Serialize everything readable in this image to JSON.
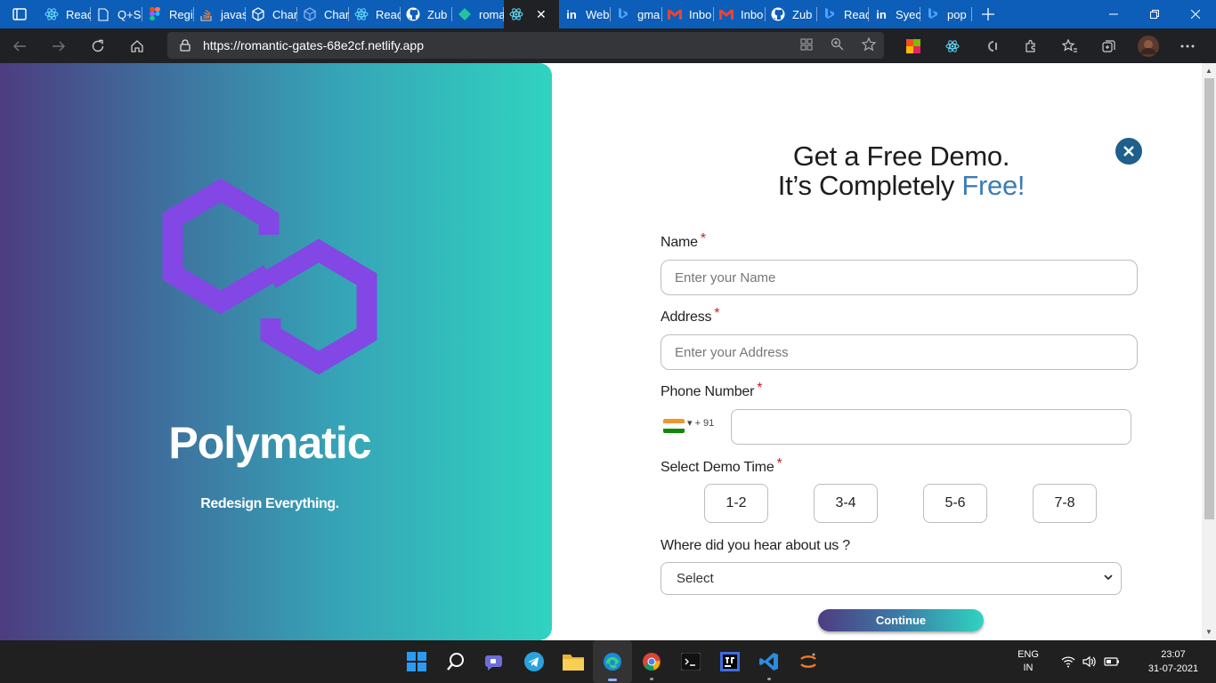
{
  "browser": {
    "tabs": [
      {
        "label": "Reac",
        "icon": "react-icon",
        "color": "#61dafb"
      },
      {
        "label": "Q+S",
        "icon": "page-icon",
        "color": "#ffffff"
      },
      {
        "label": "Regi",
        "icon": "figma-icon",
        "color": "#f24e1e"
      },
      {
        "label": "javas",
        "icon": "stackoverflow-icon",
        "color": "#f48024"
      },
      {
        "label": "Char",
        "icon": "codesandbox-icon",
        "color": "#ffffff"
      },
      {
        "label": "Char",
        "icon": "codesandbox-icon",
        "color": "#8ab4f8"
      },
      {
        "label": "Reac",
        "icon": "react-icon",
        "color": "#61dafb"
      },
      {
        "label": "Zub",
        "icon": "github-icon",
        "color": "#ffffff"
      },
      {
        "label": "roma",
        "icon": "netlify-icon",
        "color": "#25c2a0"
      }
    ],
    "active_tab": {
      "icon": "react-icon",
      "close": "✕"
    },
    "tabs_after": [
      {
        "label": "Web",
        "icon": "linkedin-icon",
        "color": "#ffffff"
      },
      {
        "label": "gma",
        "icon": "bing-icon",
        "color": "#4aa3ff"
      },
      {
        "label": "Inbo",
        "icon": "gmail-icon",
        "color": "#ea4335"
      },
      {
        "label": "Inbo",
        "icon": "gmail-icon",
        "color": "#ea4335"
      },
      {
        "label": "Zub",
        "icon": "github-icon",
        "color": "#ffffff"
      },
      {
        "label": "Reac",
        "icon": "bing-icon",
        "color": "#4aa3ff"
      },
      {
        "label": "Syec",
        "icon": "linkedin-icon",
        "color": "#ffffff"
      },
      {
        "label": "pop",
        "icon": "bing-icon",
        "color": "#4aa3ff"
      }
    ],
    "url": "https://romantic-gates-68e2cf.netlify.app"
  },
  "hero": {
    "brand": "Polymatic",
    "tagline": "Redesign Everything.",
    "colors": {
      "start": "#4d3d80",
      "end": "#30d3c0",
      "logo": "#8347e5"
    }
  },
  "form": {
    "heading_line1": "Get a Free Demo.",
    "heading_line2_prefix": "It’s Completely ",
    "heading_line2_accent": "Free!",
    "accent_color": "#3a7db5",
    "name_label": "Name",
    "name_placeholder": "Enter your Name",
    "address_label": "Address",
    "address_placeholder": "Enter your Address",
    "phone_label": "Phone Number",
    "phone_dial_code": "▾ + 91",
    "demo_time_label": "Select Demo Time",
    "slots": [
      "1-2",
      "3-4",
      "5-6",
      "7-8"
    ],
    "hear_label": "Where did you hear about us ?",
    "hear_selected": "Select",
    "continue_label": "Continue",
    "required_mark": "*"
  },
  "taskbar": {
    "language": "ENG",
    "region": "IN",
    "time": "23:07",
    "date": "31-07-2021"
  }
}
